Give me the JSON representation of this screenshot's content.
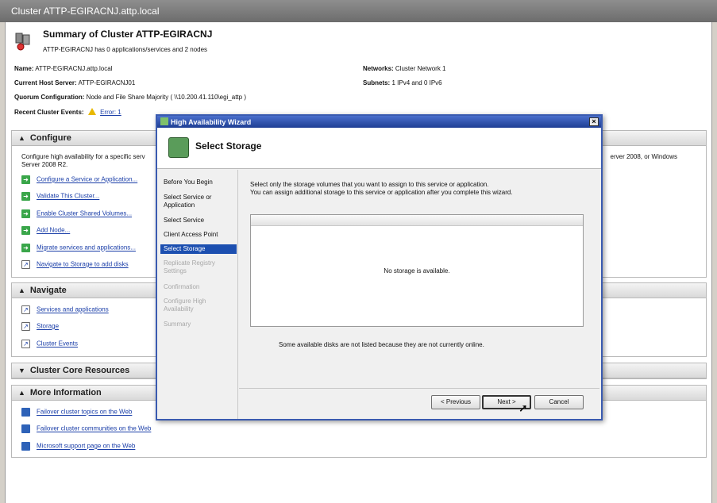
{
  "window": {
    "title": "Cluster ATTP-EGIRACNJ.attp.local"
  },
  "summary": {
    "title": "Summary of Cluster ATTP-EGIRACNJ",
    "subtitle": "ATTP-EGIRACNJ has 0 applications/services and 2 nodes"
  },
  "info": {
    "name_label": "Name:",
    "name_value": "ATTP-EGIRACNJ.attp.local",
    "host_label": "Current Host Server:",
    "host_value": "ATTP-EGIRACNJ01",
    "quorum_label": "Quorum Configuration:",
    "quorum_value": "Node and File Share Majority ( \\\\10.200.41.110\\egi_attp )",
    "events_label": "Recent Cluster Events:",
    "events_value": "Error: 1",
    "networks_label": "Networks:",
    "networks_value": "Cluster Network 1",
    "subnets_label": "Subnets:",
    "subnets_value": "1 IPv4 and 0 IPv6"
  },
  "configure": {
    "header": "Configure",
    "text_left": "Configure high availability for a specific serv",
    "text_left2": "Server 2008 R2.",
    "text_right": "erver 2008, or Windows",
    "actions": [
      {
        "label": "Configure a Service or Application...",
        "icon": "green-arrow-icon"
      },
      {
        "label": "Validate This Cluster...",
        "icon": "green-arrow-icon"
      },
      {
        "label": "Enable Cluster Shared Volumes...",
        "icon": "green-arrow-icon"
      },
      {
        "label": "Add Node...",
        "icon": "green-arrow-icon"
      },
      {
        "label": "Migrate services and applications...",
        "icon": "green-arrow-icon"
      },
      {
        "label": "Navigate to Storage to add disks",
        "icon": "link-page-icon"
      }
    ]
  },
  "navigate": {
    "header": "Navigate",
    "links": [
      "Services and applications",
      "Storage",
      "Cluster Events"
    ]
  },
  "core": {
    "header": "Cluster Core Resources"
  },
  "more_info": {
    "header": "More Information",
    "links": [
      "Failover cluster topics on the Web",
      "Failover cluster communities on the Web",
      "Microsoft support page on the Web"
    ]
  },
  "wizard": {
    "title": "High Availability Wizard",
    "close": "×",
    "header_title": "Select Storage",
    "nav": [
      {
        "label": "Before You Begin",
        "state": "normal"
      },
      {
        "label": "Select Service or Application",
        "state": "normal"
      },
      {
        "label": "Select Service",
        "state": "normal"
      },
      {
        "label": "Client Access Point",
        "state": "normal"
      },
      {
        "label": "Select Storage",
        "state": "active"
      },
      {
        "label": "Replicate Registry Settings",
        "state": "disabled"
      },
      {
        "label": "Confirmation",
        "state": "disabled"
      },
      {
        "label": "Configure High Availability",
        "state": "disabled"
      },
      {
        "label": "Summary",
        "state": "disabled"
      }
    ],
    "desc1": "Select only the storage volumes that you want to assign to this service or application.",
    "desc2": "You can assign additional storage to this service or application after you complete this wizard.",
    "empty_text": "No storage is available.",
    "note": "Some available disks are not listed because they are not currently online.",
    "buttons": {
      "previous": "< Previous",
      "next": "Next >",
      "cancel": "Cancel"
    }
  },
  "colors": {
    "link": "#1a3ea8",
    "active_nav": "#1c4fb0",
    "wizard_title": "#1e3e94"
  }
}
